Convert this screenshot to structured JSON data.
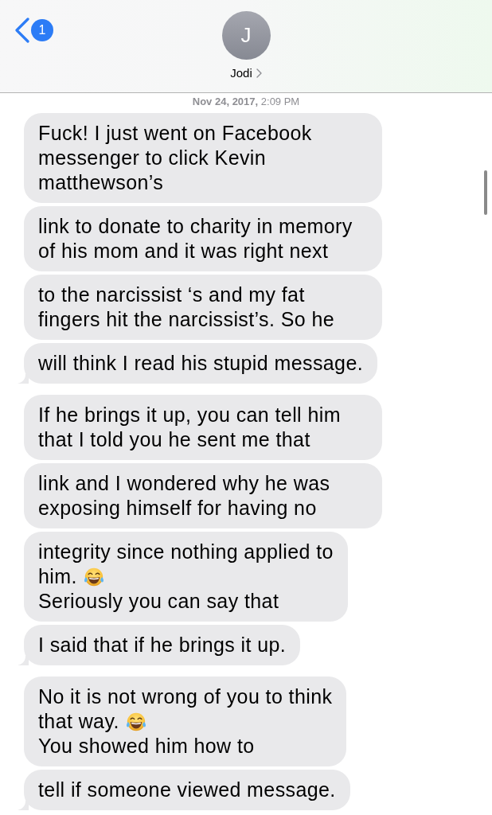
{
  "header": {
    "back_badge": "1",
    "avatar_initial": "J",
    "contact_name": "Jodi"
  },
  "timestamp": "**Nov 24, 2017,** 2:09 PM",
  "groups": [
    {
      "messages": [
        {
          "paragraphs": [
            {
              "text": "Fuck! I just went on Facebook messenger to click Kevin matthewson’s",
              "emoji": false
            }
          ]
        },
        {
          "paragraphs": [
            {
              "text": "link to donate to charity in memory of his mom and it was right next",
              "emoji": false
            }
          ]
        },
        {
          "paragraphs": [
            {
              "text": "to the narcissist ‘s and my fat fingers hit the narcissist’s. So he",
              "emoji": false
            }
          ]
        },
        {
          "paragraphs": [
            {
              "text": "will think I read his stupid message.",
              "emoji": false
            }
          ]
        }
      ]
    },
    {
      "messages": [
        {
          "paragraphs": [
            {
              "text": "If he brings it up, you can tell him that I told you he sent me that",
              "emoji": false
            }
          ]
        },
        {
          "paragraphs": [
            {
              "text": "link and I wondered why he was exposing himself for having no",
              "emoji": false
            }
          ]
        },
        {
          "paragraphs": [
            {
              "text": "integrity since nothing applied to",
              "emoji": false
            },
            {
              "text": "him.",
              "emoji": true
            },
            {
              "text": "Seriously you can say that",
              "emoji": false
            }
          ]
        },
        {
          "paragraphs": [
            {
              "text": "I said that if he brings it up.",
              "emoji": false
            }
          ]
        }
      ]
    },
    {
      "messages": [
        {
          "paragraphs": [
            {
              "text": "No it is not wrong of you to think",
              "emoji": false
            },
            {
              "text": "that way.",
              "emoji": true
            },
            {
              "text": "You showed him how to",
              "emoji": false
            }
          ]
        },
        {
          "paragraphs": [
            {
              "text": "tell if someone viewed message.",
              "emoji": false
            }
          ]
        }
      ]
    }
  ]
}
